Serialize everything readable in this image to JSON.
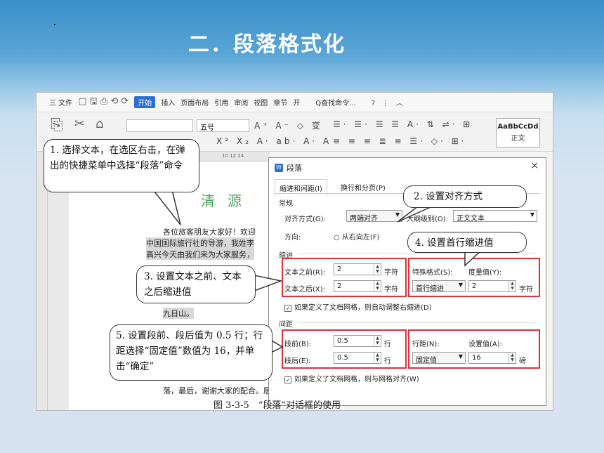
{
  "slide_title": "二．段落格式化",
  "menu": {
    "file": "三 文件",
    "start": "开始",
    "tabs": [
      "插入",
      "页面布局",
      "引用",
      "审阅",
      "视图",
      "章节",
      "开"
    ],
    "search": "Q查找命令...",
    "font_size": "五号"
  },
  "style_gallery": {
    "sample": "AaBbCcDd",
    "name": "正文"
  },
  "ruler_numbers": "10  12  14",
  "document": {
    "title": "清源",
    "lines": [
      "各位旅客朋友大家好！欢迎",
      "中国国际旅行社的导游，我姓李",
      "高兴今天由我们来为大家服务，",
      "九日山。",
      "落，最后，谢谢大家的配合。愿"
    ]
  },
  "dialog": {
    "title": "段落",
    "close": "×",
    "tabs": [
      "缩进和间距(I)",
      "换行和分页(P)"
    ],
    "general": {
      "section": "常规",
      "align_label": "对齐方式(G):",
      "align_value": "两端对齐",
      "outline_label": "大纲级别(O):",
      "outline_value": "正文文本",
      "direction_label": "方向:",
      "rtl_label": "从右向左(F)"
    },
    "indent": {
      "section": "缩进",
      "before_label": "文本之前(R):",
      "before_value": "2",
      "after_label": "文本之后(X):",
      "after_value": "2",
      "unit": "字符",
      "special_label": "特殊格式(S):",
      "special_value": "首行缩进",
      "measure_label": "度量值(Y):",
      "measure_value": "2",
      "measure_unit": "字符",
      "grid_check": "如果定义了文档网格，则自动调整右缩进(D)"
    },
    "spacing": {
      "section": "间距",
      "before_label": "段前(B):",
      "before_value": "0.5",
      "after_label": "段后(E):",
      "after_value": "0.5",
      "unit": "行",
      "line_label": "行距(N):",
      "line_value": "固定值",
      "set_label": "设置值(A):",
      "set_value": "16",
      "set_unit": "磅",
      "grid_check": "如果定义了文档网格，则与网格对齐(W)"
    }
  },
  "callouts": {
    "c1": "1. 选择文本，在选区右击，在弹出的快捷菜单中选择“段落”命令",
    "c2": "2. 设置对齐方式",
    "c3": "3. 设置文本之前、文本之后缩进值",
    "c4": "4. 设置首行缩进值",
    "c5": "5. 设置段前、段后值为 0.5 行；行距选择“固定值”数值为 16，并单击“确定”"
  },
  "caption": "图 3-3-5　“段落”对话框的使用",
  "colors": {
    "highlight_box": "#e0303a",
    "doc_title": "#4aa35a",
    "accent": "#2b6fd6"
  }
}
